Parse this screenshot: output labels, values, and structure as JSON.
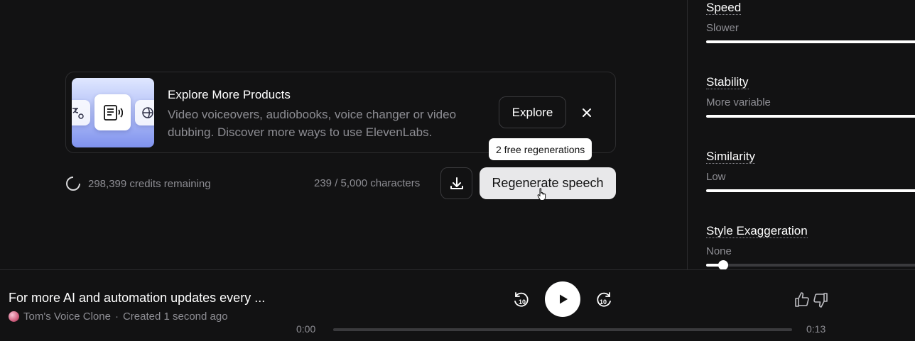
{
  "promo": {
    "title": "Explore More Products",
    "description": "Video voiceovers, audiobooks, voice changer or video dubbing. Discover more ways to use ElevenLabs.",
    "explore_label": "Explore"
  },
  "tooltip": {
    "text": "2 free regenerations"
  },
  "footer": {
    "credits": "298,399 credits remaining",
    "characters": "239 / 5,000 characters",
    "regenerate_label": "Regenerate speech"
  },
  "settings": {
    "speed": {
      "title": "Speed",
      "sub": "Slower"
    },
    "stability": {
      "title": "Stability",
      "sub": "More variable"
    },
    "similarity": {
      "title": "Similarity",
      "sub": "Low"
    },
    "style": {
      "title": "Style Exaggeration",
      "sub": "None",
      "value_fraction": 0.08
    }
  },
  "player": {
    "title": "For more AI and automation updates every ...",
    "voice": "Tom's Voice Clone",
    "separator": "·",
    "created": "Created 1 second ago",
    "time_current": "0:00",
    "time_total": "0:13",
    "skip_seconds": "10",
    "progress_fraction": 0
  },
  "icons": {
    "loader": "loading-ring-icon",
    "download": "download-icon",
    "close": "close-icon",
    "play": "play-icon",
    "rewind": "rewind-10-icon",
    "forward": "forward-10-icon",
    "like": "thumbs-up-icon",
    "dislike": "thumbs-down-icon"
  }
}
